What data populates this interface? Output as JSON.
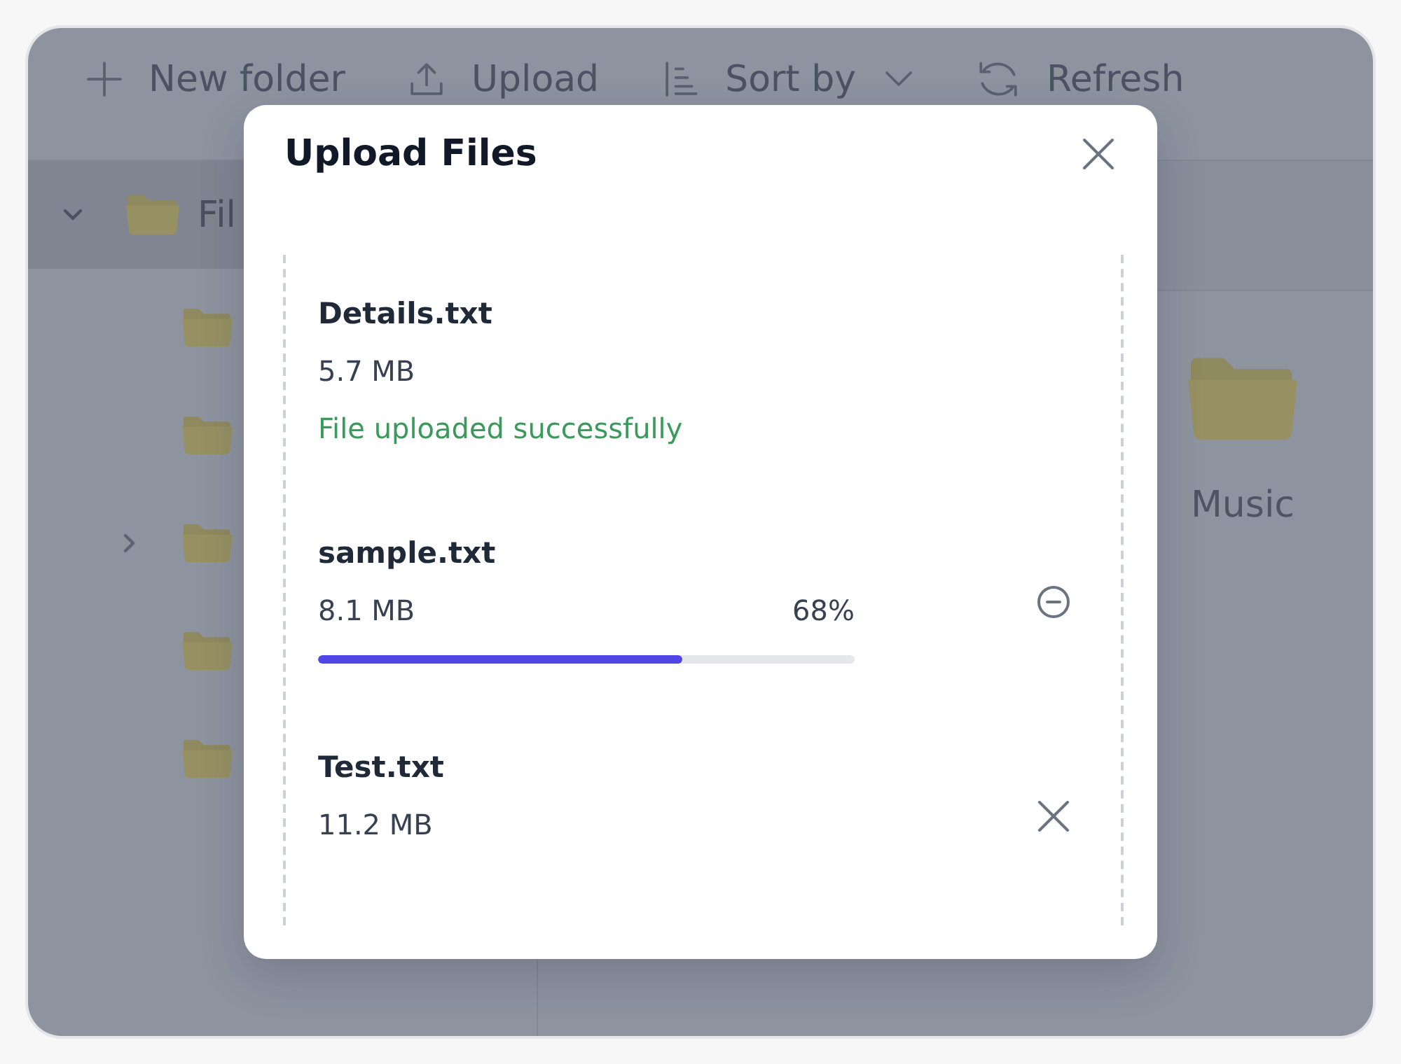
{
  "toolbar": {
    "actions": [
      {
        "kind": "add",
        "label": "New folder",
        "dropdown": false
      },
      {
        "kind": "upload",
        "label": "Upload",
        "dropdown": false
      },
      {
        "kind": "sort",
        "label": "Sort by",
        "dropdown": true
      },
      {
        "kind": "refresh",
        "label": "Refresh",
        "dropdown": false
      }
    ]
  },
  "sidebar": {
    "tree": [
      {
        "kind": "branch",
        "label": "Fil",
        "selected": true,
        "expanded": true,
        "children": [
          {
            "kind": "leaf"
          },
          {
            "kind": "leaf"
          },
          {
            "kind": "branch",
            "expanded": false
          },
          {
            "kind": "leaf"
          },
          {
            "kind": "leaf"
          }
        ]
      }
    ]
  },
  "content": {
    "items": [
      {
        "label": "Music"
      }
    ]
  },
  "dialog": {
    "title": "Upload Files",
    "uploads": [
      {
        "kind": "done",
        "name": "Details.txt",
        "size": "5.7 MB",
        "message": "File uploaded successfully"
      },
      {
        "kind": "uploading",
        "name": "sample.txt",
        "size": "8.1 MB",
        "percent": "68%",
        "level": 0.68
      },
      {
        "kind": "queued",
        "name": "Test.txt",
        "size": "11.2 MB"
      }
    ]
  }
}
